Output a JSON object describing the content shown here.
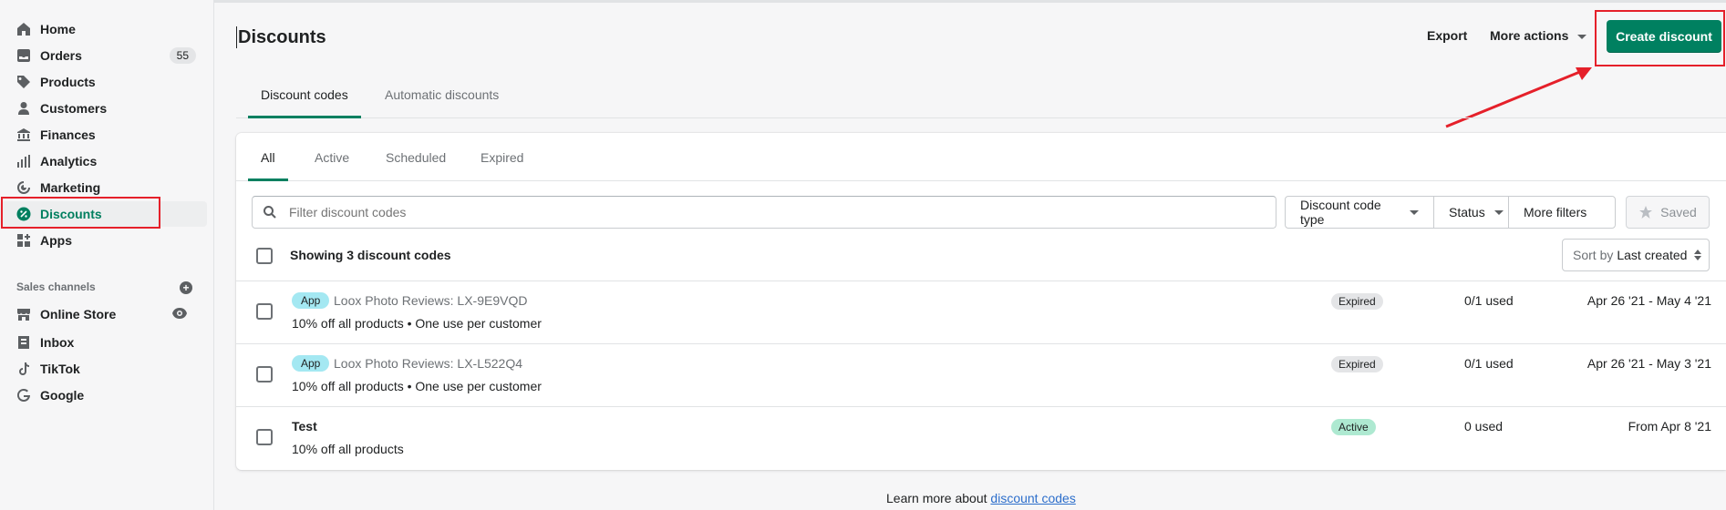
{
  "sidebar": {
    "items": [
      {
        "label": "Home",
        "icon": "home-icon"
      },
      {
        "label": "Orders",
        "icon": "orders-icon",
        "badge": "55"
      },
      {
        "label": "Products",
        "icon": "tag-icon"
      },
      {
        "label": "Customers",
        "icon": "person-icon"
      },
      {
        "label": "Finances",
        "icon": "bank-icon"
      },
      {
        "label": "Analytics",
        "icon": "bar-chart-icon"
      },
      {
        "label": "Marketing",
        "icon": "target-icon"
      },
      {
        "label": "Discounts",
        "icon": "discount-icon"
      },
      {
        "label": "Apps",
        "icon": "apps-icon"
      }
    ],
    "sales_channels_label": "Sales channels",
    "channels": [
      {
        "label": "Online Store",
        "icon": "store-icon"
      },
      {
        "label": "Inbox",
        "icon": "inbox-icon"
      },
      {
        "label": "TikTok",
        "icon": "tiktok-icon"
      },
      {
        "label": "Google",
        "icon": "google-icon"
      }
    ]
  },
  "header": {
    "title": "Discounts",
    "export_label": "Export",
    "more_actions_label": "More actions",
    "create_label": "Create discount"
  },
  "top_tabs": [
    "Discount codes",
    "Automatic discounts"
  ],
  "card": {
    "tabs": [
      "All",
      "Active",
      "Scheduled",
      "Expired"
    ],
    "filter_placeholder": "Filter discount codes",
    "filters": {
      "type_label": "Discount code type",
      "status_label": "Status",
      "more_label": "More filters",
      "saved_label": "Saved"
    },
    "showing_label": "Showing 3 discount codes",
    "sort": {
      "prefix": "Sort by",
      "value": "Last created"
    },
    "rows": [
      {
        "badge": "App",
        "name": "Loox Photo Reviews: LX-9E9VQD",
        "desc": "10% off all products • One use per customer",
        "status": "Expired",
        "used": "0/1 used",
        "dates": "Apr 26 '21 - May 4 '21"
      },
      {
        "badge": "App",
        "name": "Loox Photo Reviews: LX-L522Q4",
        "desc": "10% off all products • One use per customer",
        "status": "Expired",
        "used": "0/1 used",
        "dates": "Apr 26 '21 - May 3 '21"
      },
      {
        "badge": "",
        "name": "Test",
        "desc": "10% off all products",
        "status": "Active",
        "used": "0 used",
        "dates": "From Apr 8 '21"
      }
    ]
  },
  "footer": {
    "prefix": "Learn more about",
    "link": "discount codes"
  },
  "colors": {
    "accent": "#008060",
    "annotation": "#e5202a"
  }
}
